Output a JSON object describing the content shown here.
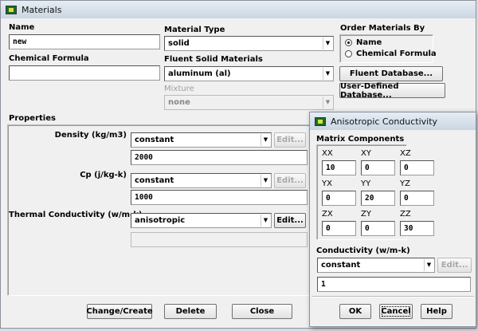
{
  "materials": {
    "title": "Materials",
    "name_label": "Name",
    "name_value": "new",
    "formula_label": "Chemical Formula",
    "formula_value": "",
    "material_type_label": "Material Type",
    "material_type_value": "solid",
    "fluent_materials_label": "Fluent Solid Materials",
    "fluent_materials_value": "aluminum (al)",
    "mixture_label": "Mixture",
    "mixture_value": "none",
    "order_label": "Order Materials By",
    "order_options": [
      "Name",
      "Chemical Formula"
    ],
    "order_selected": "Name",
    "fluent_db_button": "Fluent Database...",
    "user_db_button": "User-Defined Database...",
    "properties_label": "Properties",
    "properties": [
      {
        "label": "Density (kg/m3)",
        "method": "constant",
        "value": "2000",
        "edit": "Edit..."
      },
      {
        "label": "Cp (j/kg-k)",
        "method": "constant",
        "value": "1000",
        "edit": "Edit..."
      },
      {
        "label": "Thermal Conductivity (w/m-k)",
        "method": "anisotropic",
        "value": "",
        "edit": "Edit..."
      }
    ],
    "buttons": {
      "change_create": "Change/Create",
      "delete": "Delete",
      "close": "Close"
    }
  },
  "aniso": {
    "title": "Anisotropic Conductivity",
    "matrix_label": "Matrix Components",
    "cells": [
      {
        "label": "XX",
        "value": "10"
      },
      {
        "label": "XY",
        "value": "0"
      },
      {
        "label": "XZ",
        "value": "0"
      },
      {
        "label": "YX",
        "value": "0"
      },
      {
        "label": "YY",
        "value": "20"
      },
      {
        "label": "YZ",
        "value": "0"
      },
      {
        "label": "ZX",
        "value": "0"
      },
      {
        "label": "ZY",
        "value": "0"
      },
      {
        "label": "ZZ",
        "value": "30"
      }
    ],
    "conductivity_label": "Conductivity (w/m-k)",
    "conductivity_method": "constant",
    "conductivity_value": "1",
    "edit": "Edit...",
    "ok": "OK",
    "cancel": "Cancel",
    "help": "Help"
  }
}
